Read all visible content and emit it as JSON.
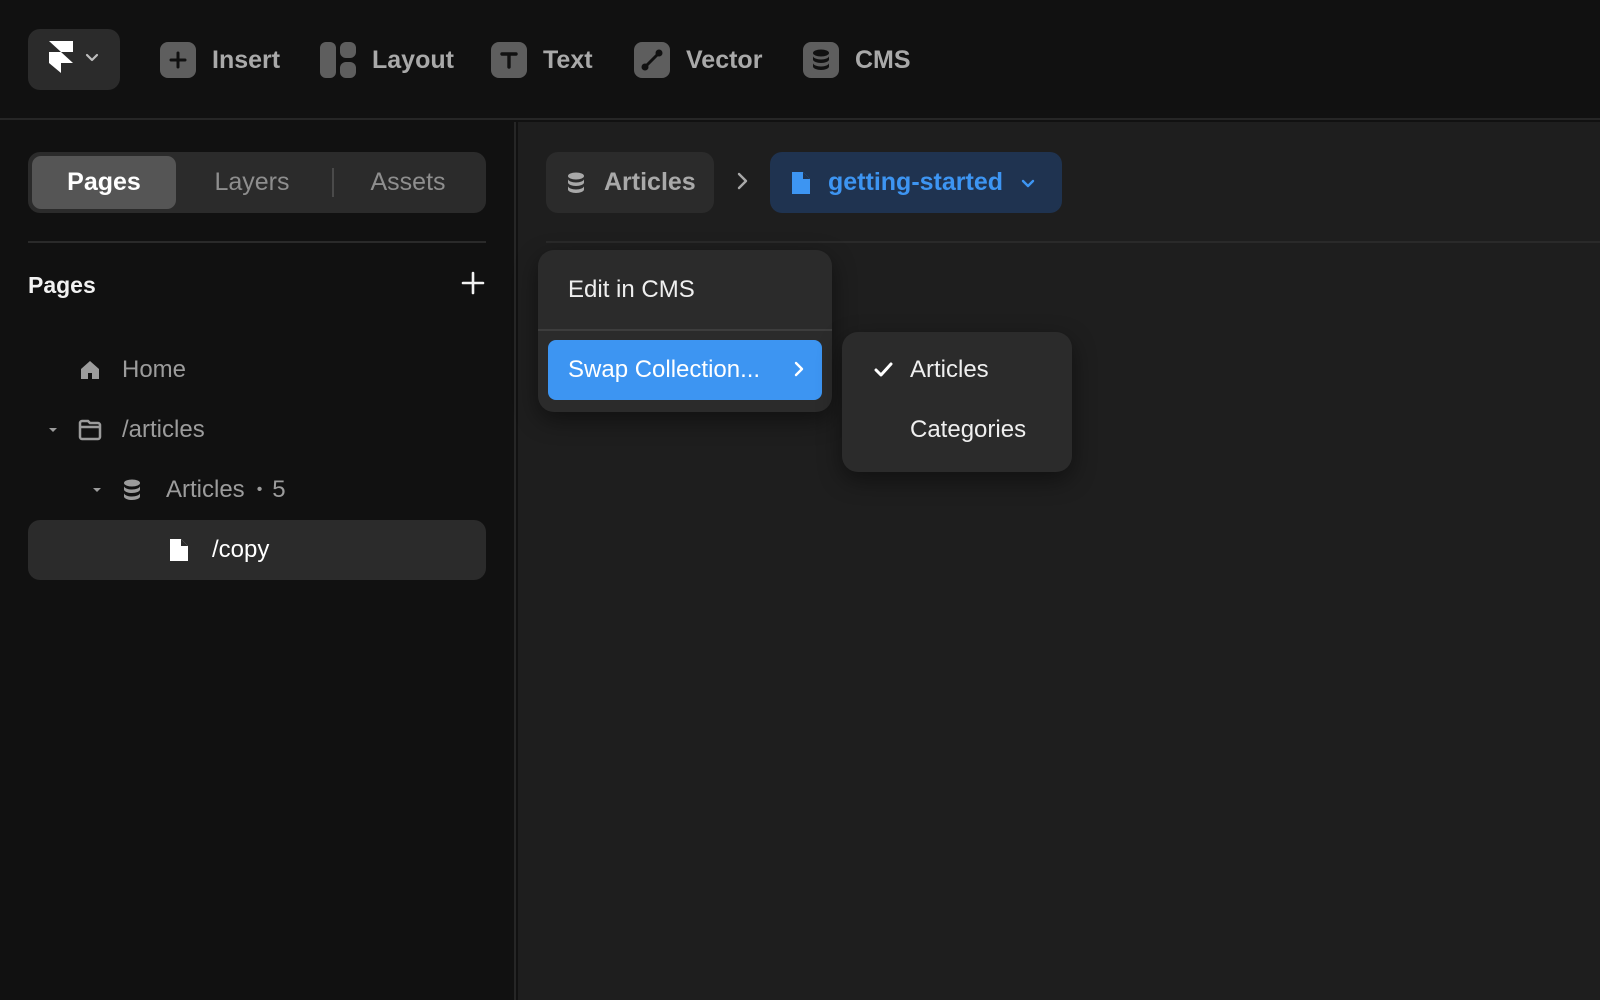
{
  "toolbar": {
    "tools": [
      {
        "label": "Insert",
        "icon": "plus-square-icon"
      },
      {
        "label": "Layout",
        "icon": "layout-icon"
      },
      {
        "label": "Text",
        "icon": "text-icon"
      },
      {
        "label": "Vector",
        "icon": "pen-tool-icon"
      },
      {
        "label": "CMS",
        "icon": "database-icon"
      }
    ]
  },
  "sidebar": {
    "tabs": [
      {
        "label": "Pages",
        "active": true
      },
      {
        "label": "Layers",
        "active": false
      },
      {
        "label": "Assets",
        "active": false
      }
    ],
    "section_title": "Pages",
    "tree": [
      {
        "label": "Home",
        "icon": "home-icon"
      },
      {
        "label": "/articles",
        "icon": "folder-icon",
        "expanded": true
      },
      {
        "label": "Articles",
        "icon": "database-icon",
        "count": "5",
        "separator": "•",
        "expanded": true
      },
      {
        "label": "/copy",
        "icon": "file-icon",
        "selected": true
      }
    ]
  },
  "breadcrumb": {
    "collection": "Articles",
    "page": "getting-started"
  },
  "context_menu": {
    "items": [
      {
        "label": "Edit in CMS"
      },
      {
        "label": "Swap Collection...",
        "highlighted": true
      }
    ]
  },
  "submenu": {
    "items": [
      {
        "label": "Articles",
        "checked": true
      },
      {
        "label": "Categories",
        "checked": false
      }
    ]
  },
  "colors": {
    "accent": "#3d95f2",
    "background": "#111111",
    "canvas": "#1e1e1e",
    "panel": "#2b2b2b"
  }
}
